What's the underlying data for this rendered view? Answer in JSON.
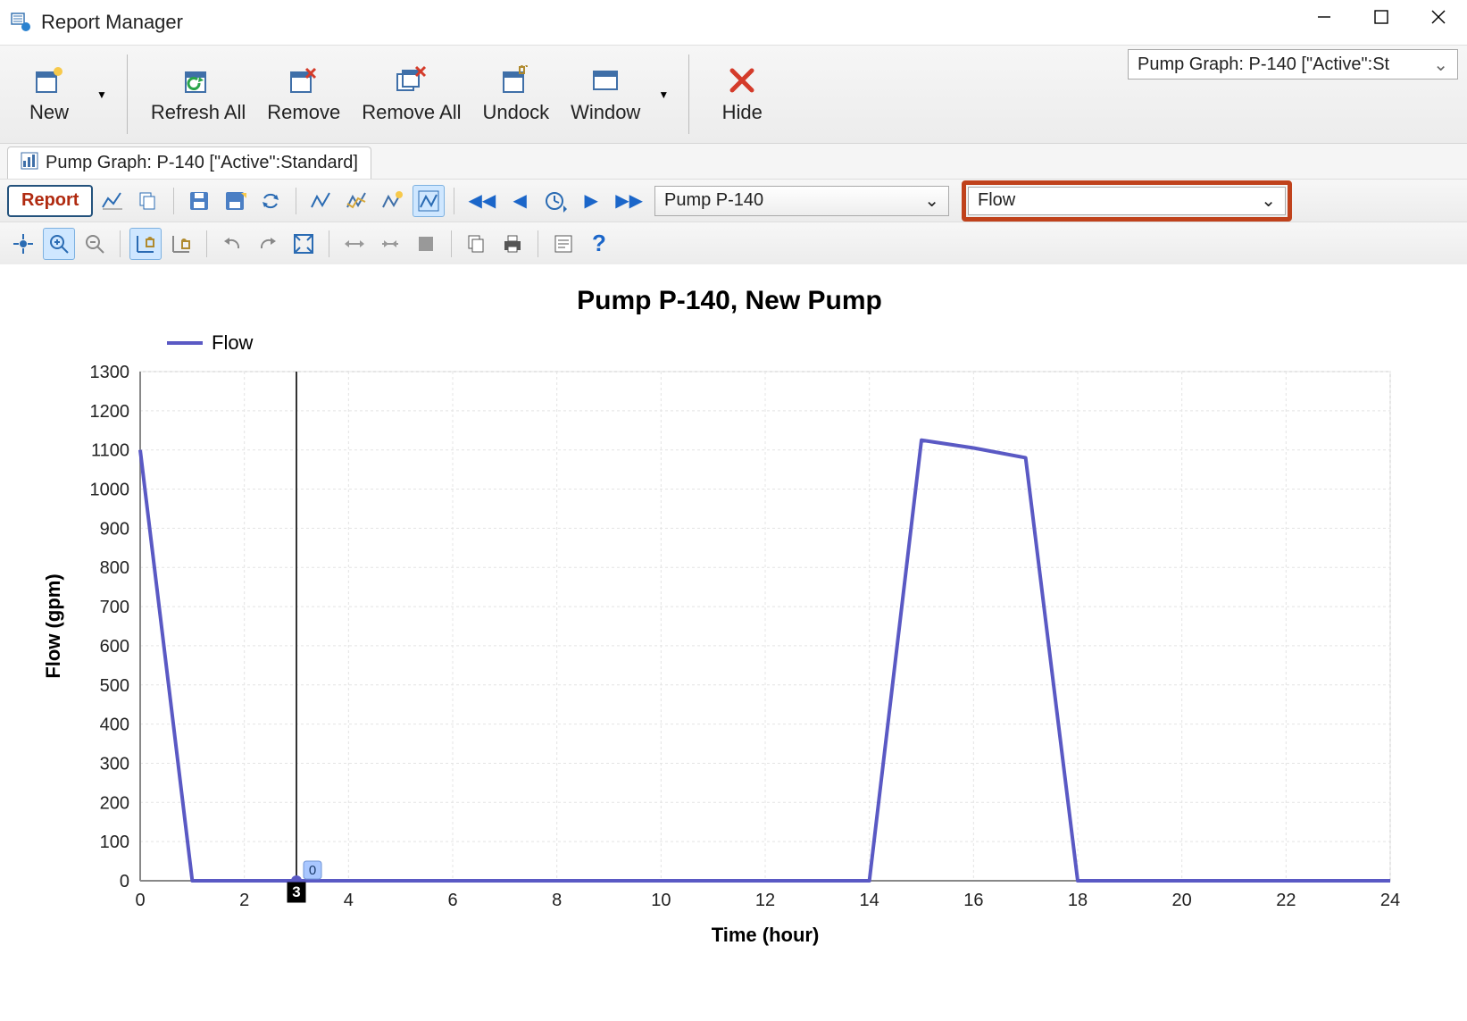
{
  "window": {
    "title": "Report Manager"
  },
  "main_toolbar": {
    "new": "New",
    "refresh_all": "Refresh All",
    "remove": "Remove",
    "remove_all": "Remove All",
    "undock": "Undock",
    "window": "Window",
    "hide": "Hide"
  },
  "view_selector": "Pump Graph: P-140 [\"Active\":St",
  "tab": {
    "label": "Pump Graph: P-140 [\"Active\":Standard]"
  },
  "sec_toolbar": {
    "report_label": "Report"
  },
  "nav": {
    "pump_select": "Pump P-140",
    "param_select": "Flow"
  },
  "chart_data": {
    "type": "line",
    "title": "Pump P-140, New Pump",
    "xlabel": "Time (hour)",
    "ylabel": "Flow (gpm)",
    "x_ticks": [
      0,
      2,
      4,
      6,
      8,
      10,
      12,
      14,
      16,
      18,
      20,
      22,
      24
    ],
    "y_ticks": [
      0,
      100,
      200,
      300,
      400,
      500,
      600,
      700,
      800,
      900,
      1000,
      1100,
      1200,
      1300
    ],
    "xlim": [
      0,
      24
    ],
    "ylim": [
      0,
      1300
    ],
    "legend": [
      "Flow"
    ],
    "legend_color": "#5a59c4",
    "cursor_x": 3,
    "cursor_marker": "3",
    "cursor_balloon": "0",
    "series": [
      {
        "name": "Flow",
        "x": [
          0,
          1,
          2,
          3,
          4,
          5,
          6,
          7,
          8,
          9,
          10,
          11,
          12,
          13,
          14,
          15,
          16,
          17,
          18,
          19,
          20,
          21,
          22,
          23,
          24
        ],
        "values": [
          1100,
          0,
          0,
          0,
          0,
          0,
          0,
          0,
          0,
          0,
          0,
          0,
          0,
          0,
          0,
          1125,
          1105,
          1080,
          0,
          0,
          0,
          0,
          0,
          0,
          0
        ]
      }
    ]
  }
}
